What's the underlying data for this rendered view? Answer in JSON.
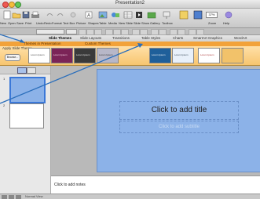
{
  "window": {
    "title": "Presentation2"
  },
  "toolbar": {
    "items": [
      "New",
      "Open",
      "Save",
      "Print",
      "Undo",
      "Redo",
      "Format",
      "Text Box",
      "Picture",
      "Shapes",
      "Table",
      "Media",
      "New Slide",
      "Slide Show",
      "Gallery",
      "Toolbox",
      "Zoom",
      "Help"
    ],
    "zoom": "37%"
  },
  "ribbon": {
    "tabs": [
      "Slide Themes",
      "Slide Layouts",
      "Transitions",
      "Table Styles",
      "Charts",
      "SmartArt Graphics",
      "WordArt"
    ]
  },
  "subtabs": {
    "items": [
      "Themes in Presentation",
      "Custom Themes"
    ],
    "apply_label": "Apply Slide Theme",
    "browse_label": "Browse..."
  },
  "gallery": {
    "themes": [
      "Lorem Ipsum",
      "Lorem Ipsum",
      "Lorem Ipsum",
      "Lorem Ipsum",
      "Lorem Ipsum",
      "Lorem Ipsum",
      "Lorem Ipsum"
    ]
  },
  "slides": [
    {
      "number": "1"
    },
    {
      "number": "2"
    }
  ],
  "slide": {
    "title_placeholder": "Click to add title",
    "subtitle_placeholder": "Click to add subtitle"
  },
  "notes": {
    "placeholder": "Click to add notes"
  },
  "status": {
    "view": "Normal View"
  },
  "colors": {
    "accent": "#f2a23a",
    "slide": "#8cb2e8",
    "arrow": "#2a6ebb"
  }
}
